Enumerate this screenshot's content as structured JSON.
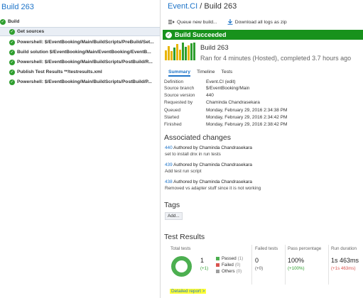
{
  "left": {
    "title": "Build 263",
    "root_label": "Build",
    "steps": [
      {
        "label": "Get sources"
      },
      {
        "label": "Powershell: $/EventBooking/Main/BuildScripts/PreBuild/Set..."
      },
      {
        "label": "Build solution $/EventBooking/Main/EventBooking/EventB..."
      },
      {
        "label": "Powershell: $/EventBooking/Main/BuildScripts/PostBuild/R..."
      },
      {
        "label": "Publish Test Results **/testresults.xml"
      },
      {
        "label": "Powershell: $/EventBooking/Main/BuildScripts/PostBuild/P..."
      }
    ]
  },
  "breadcrumb": {
    "definition": "Event.CI",
    "separator": " / ",
    "build": "Build 263"
  },
  "toolbar": {
    "queue": "Queue new build...",
    "download": "Download all logs as zip"
  },
  "banner": {
    "text": "Build Succeeded",
    "color": "#18921c"
  },
  "history_bars": [
    {
      "level": 0.55,
      "color": "#e8b400"
    },
    {
      "level": 0.8,
      "color": "#e8b400"
    },
    {
      "level": 0.5,
      "color": "#e8b400"
    },
    {
      "level": 0.7,
      "color": "#2e9e2e"
    },
    {
      "level": 0.9,
      "color": "#e8b400"
    },
    {
      "level": 0.6,
      "color": "#e8b400"
    },
    {
      "level": 1.0,
      "color": "#2e9e2e"
    },
    {
      "level": 0.75,
      "color": "#2e9e2e"
    },
    {
      "level": 0.85,
      "color": "#e8b400"
    },
    {
      "level": 0.95,
      "color": "#2e9e2e"
    },
    {
      "level": 1.0,
      "color": "#2e9e2e"
    }
  ],
  "build": {
    "name": "Build 263",
    "status": "Ran for 4 minutes (Hosted), completed 3.7 hours ago"
  },
  "tabs": [
    "Summary",
    "Timeline",
    "Tests"
  ],
  "details": [
    {
      "label": "Definition",
      "value": "Event.CI (edit)",
      "link": true
    },
    {
      "label": "Source branch",
      "value": "$/EventBooking/Main",
      "link": false
    },
    {
      "label": "Source version",
      "value": "440",
      "link": true
    },
    {
      "label": "Requested by",
      "value": "Chaminda Chandrasekara",
      "link": false
    },
    {
      "label": "Queued",
      "value": "Monday, February 29, 2016 2:34:38 PM",
      "link": false
    },
    {
      "label": "Started",
      "value": "Monday, February 29, 2016 2:34:42 PM",
      "link": false
    },
    {
      "label": "Finished",
      "value": "Monday, February 29, 2016 2:38:42 PM",
      "link": false
    }
  ],
  "changes_title": "Associated changes",
  "changes": [
    {
      "id": "440",
      "author": "Authored by Chaminda Chandrasekara",
      "message": "set to install dnx in run tests"
    },
    {
      "id": "439",
      "author": "Authored by Chaminda Chandrasekara",
      "message": "Add test run script"
    },
    {
      "id": "438",
      "author": "Authored by Chaminda Chandrasekara",
      "message": "Removed vs adapter stuff since it is not working"
    }
  ],
  "tags": {
    "title": "Tags",
    "add": "Add..."
  },
  "tests": {
    "title": "Test Results",
    "headers": {
      "total": "Total tests",
      "failed": "Failed tests",
      "pass": "Pass percentage",
      "duration": "Run duration"
    },
    "total": "1",
    "total_delta": "(+1)",
    "passed_label": "Passed",
    "passed_count": "(1)",
    "failed_label": "Failed",
    "failed_count": "(0)",
    "others_label": "Others",
    "others_count": "(0)",
    "failed": "0",
    "failed_delta": "(+0)",
    "pass_pct": "100%",
    "pass_delta": "(+100%)",
    "duration": "1s 463ms",
    "duration_delta": "(+1s 463ms)",
    "colors": {
      "passed": "#4caf50",
      "failed": "#d9534f",
      "others": "#9e9e9e"
    },
    "report_link": "Detailed report >"
  }
}
